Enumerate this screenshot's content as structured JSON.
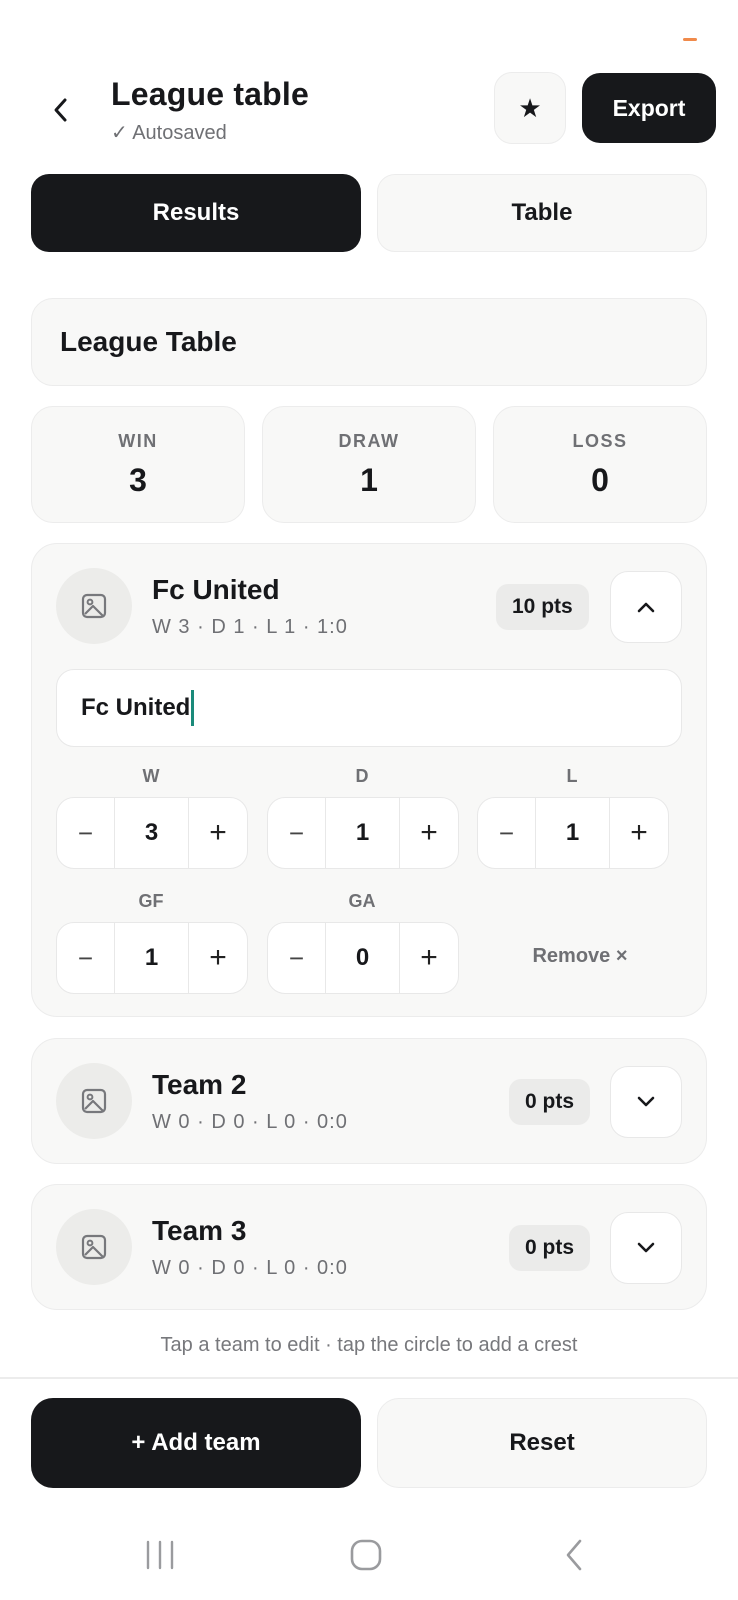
{
  "header": {
    "back_icon": "chevron-left-icon",
    "title": "League table",
    "autosave": "✓ Autosaved",
    "star_icon": "star-icon",
    "star_glyph": "★",
    "export_label": "Export"
  },
  "tabs": [
    {
      "label": "Results",
      "active": true
    },
    {
      "label": "Table",
      "active": false
    }
  ],
  "league_name": "League Table",
  "points": [
    {
      "label": "WIN",
      "value": "3"
    },
    {
      "label": "DRAW",
      "value": "1"
    },
    {
      "label": "LOSS",
      "value": "0"
    }
  ],
  "teams": [
    {
      "name": "Fc United",
      "summary": "W 3 · D 1 · L 1 · 1:0",
      "pts": "10 pts",
      "expanded": true,
      "input_value": "Fc United",
      "stats": [
        {
          "label": "W",
          "value": "3"
        },
        {
          "label": "D",
          "value": "1"
        },
        {
          "label": "L",
          "value": "1"
        },
        {
          "label": "GF",
          "value": "1"
        },
        {
          "label": "GA",
          "value": "0"
        }
      ],
      "remove_label": "Remove ×"
    },
    {
      "name": "Team 2",
      "summary": "W 0 · D 0 · L 0 · 0:0",
      "pts": "0 pts",
      "expanded": false
    },
    {
      "name": "Team 3",
      "summary": "W 0 · D 0 · L 0 · 0:0",
      "pts": "0 pts",
      "expanded": false
    }
  ],
  "stepper": {
    "minus": "−",
    "plus": "+"
  },
  "hint": "Tap a team to edit · tap the circle to add a crest",
  "actions": {
    "add_label": "+ Add team",
    "reset_label": "Reset"
  },
  "colors": {
    "primary": "#17181b",
    "surface": "#f8f8f7",
    "accent_caret": "#1a8a7a",
    "status_dash": "#f08a4b"
  }
}
